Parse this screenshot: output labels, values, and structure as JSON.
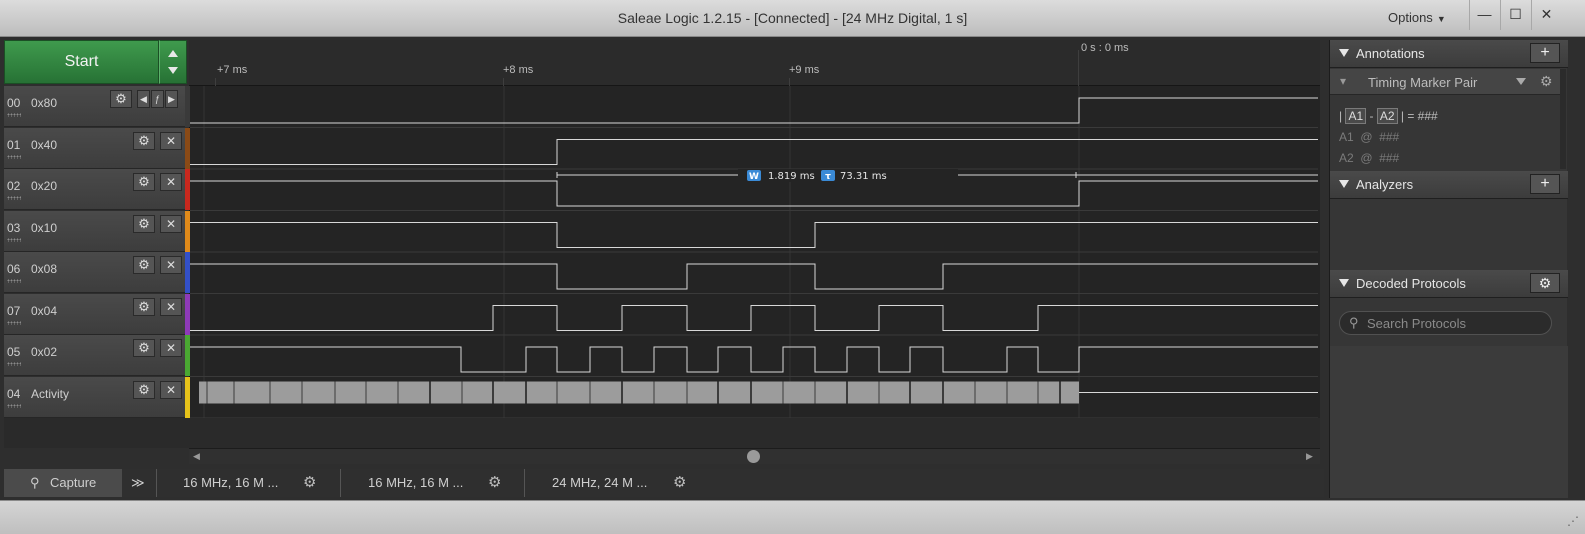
{
  "window": {
    "title": "Saleae Logic 1.2.15 - [Connected] - [24 MHz Digital, 1 s]",
    "options_label": "Options",
    "buttons": {
      "minimize": "—",
      "maximize": "☐",
      "close": "✕"
    }
  },
  "start_label": "Start",
  "timeline": {
    "marker_zero": "0 s : 0 ms",
    "ticks": [
      "+7 ms",
      "+8 ms",
      "+9 ms"
    ]
  },
  "channels": [
    {
      "num": "00",
      "name": "0x80",
      "color": "#3a3a3a"
    },
    {
      "num": "01",
      "name": "0x40",
      "color": "#8a4a16"
    },
    {
      "num": "02",
      "name": "0x20",
      "color": "#c8281e"
    },
    {
      "num": "03",
      "name": "0x10",
      "color": "#e08a1a"
    },
    {
      "num": "06",
      "name": "0x08",
      "color": "#3350c8"
    },
    {
      "num": "07",
      "name": "0x04",
      "color": "#8e3ab8"
    },
    {
      "num": "05",
      "name": "0x02",
      "color": "#4aa832"
    },
    {
      "num": "04",
      "name": "Activity",
      "color": "#e6c21a"
    }
  ],
  "measurement": {
    "width_badge": "W",
    "width": "1.819 ms",
    "period_badge": "τ",
    "period": "73.31 ms"
  },
  "tabs": {
    "capture": "Capture",
    "more": "≫",
    "sessions": [
      "16 MHz, 16 M ...",
      "16 MHz, 16 M ...",
      "24 MHz, 24 M ..."
    ]
  },
  "sidebar": {
    "annotations": {
      "title": "Annotations",
      "add": "+",
      "selector": "Timing Marker Pair",
      "line1": {
        "a1": "A1",
        "sep": "-",
        "a2": "A2",
        "value": "= ###"
      },
      "line2": "A1  @  ###",
      "line3": "A2  @  ###"
    },
    "analyzers": {
      "title": "Analyzers",
      "add": "+"
    },
    "decoded": {
      "title": "Decoded Protocols",
      "search_placeholder": "Search Protocols"
    }
  }
}
